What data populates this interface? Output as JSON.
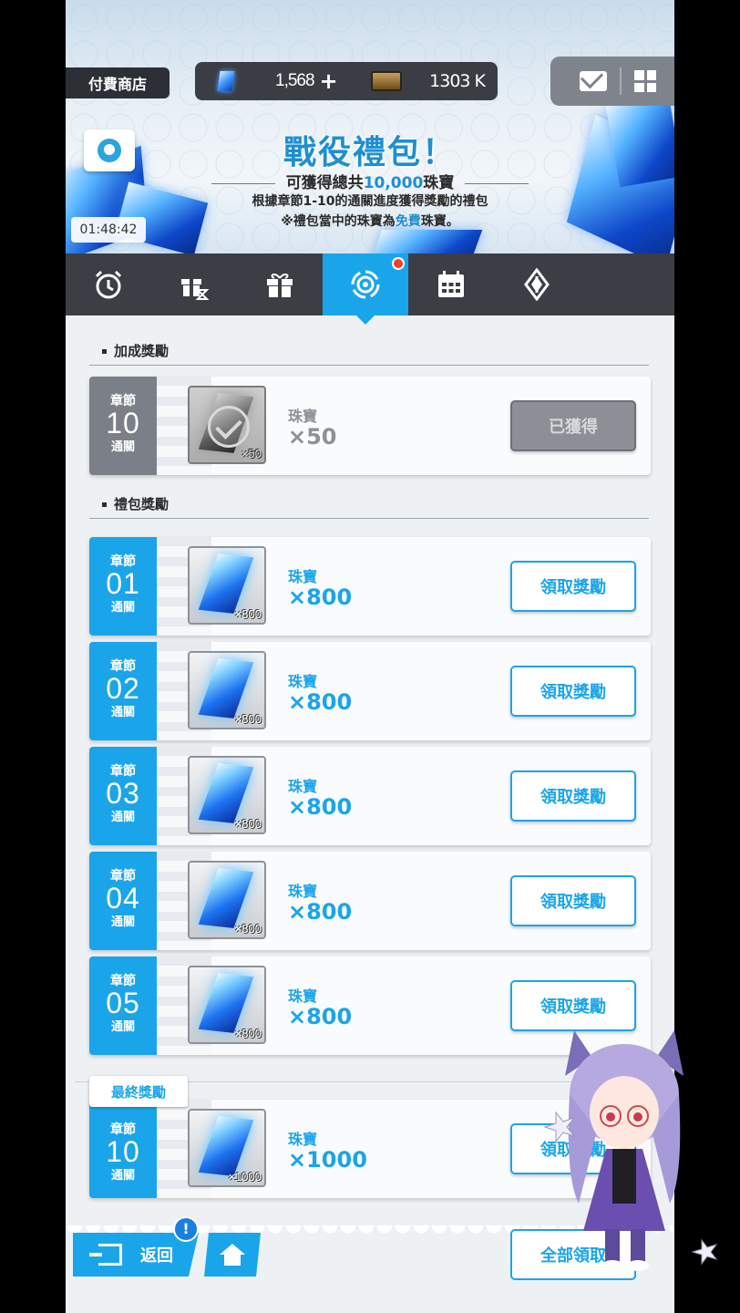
{
  "header": {
    "shop_label": "付費商店",
    "gems": "1,568",
    "gems_plus": "+",
    "credits": "1303 K"
  },
  "banner": {
    "title": "戰役禮包！",
    "subtitle_pre": "可獲得總共",
    "subtitle_amount": "10,000",
    "subtitle_post": "珠寶",
    "desc_line1": "根據章節1-10的通關進度獲得獎勵的禮包",
    "desc_line2_pre": "※禮包當中的珠寶為",
    "desc_line2_free": "免費",
    "desc_line2_post": "珠寶。",
    "timer": "01:48:42"
  },
  "tabs": [
    {
      "icon": "alarm-clock-icon",
      "active": false
    },
    {
      "icon": "gift-timer-icon",
      "active": false
    },
    {
      "icon": "gift-icon",
      "active": false
    },
    {
      "icon": "target-icon",
      "active": true,
      "badge": true
    },
    {
      "icon": "calendar-icon",
      "active": false
    },
    {
      "icon": "diamond-emblem-icon",
      "active": false
    }
  ],
  "sections": {
    "bonus_title": "加成獎勵",
    "package_title": "禮包獎勵"
  },
  "bonus_reward": {
    "chapter_label": "章節",
    "chapter_num": "10",
    "cleared_label": "通關",
    "item_qty": "×50",
    "reward_name": "珠寶",
    "reward_amount": "×50",
    "button": "已獲得"
  },
  "package_rewards": [
    {
      "chapter_label": "章節",
      "chapter_num": "01",
      "cleared_label": "通關",
      "item_qty": "×800",
      "reward_name": "珠寶",
      "reward_amount": "×800",
      "button": "領取獎勵"
    },
    {
      "chapter_label": "章節",
      "chapter_num": "02",
      "cleared_label": "通關",
      "item_qty": "×800",
      "reward_name": "珠寶",
      "reward_amount": "×800",
      "button": "領取獎勵"
    },
    {
      "chapter_label": "章節",
      "chapter_num": "03",
      "cleared_label": "通關",
      "item_qty": "×800",
      "reward_name": "珠寶",
      "reward_amount": "×800",
      "button": "領取獎勵"
    },
    {
      "chapter_label": "章節",
      "chapter_num": "04",
      "cleared_label": "通關",
      "item_qty": "×800",
      "reward_name": "珠寶",
      "reward_amount": "×800",
      "button": "領取獎勵"
    },
    {
      "chapter_label": "章節",
      "chapter_num": "05",
      "cleared_label": "通關",
      "item_qty": "×800",
      "reward_name": "珠寶",
      "reward_amount": "×800",
      "button": "領取獎勵"
    }
  ],
  "final_reward": {
    "tag": "最終獎勵",
    "chapter_label": "章節",
    "chapter_num": "10",
    "cleared_label": "通關",
    "item_qty": "×1000",
    "reward_name": "珠寶",
    "reward_amount": "×1000",
    "button": "領取獎勵"
  },
  "bottom": {
    "back_label": "返回",
    "alert_badge": "!",
    "claim_all": "全部領取"
  },
  "colors": {
    "accent": "#1aa5ea",
    "tab_bar": "#3b3e45",
    "claimed_grey": "#7b7f88"
  }
}
